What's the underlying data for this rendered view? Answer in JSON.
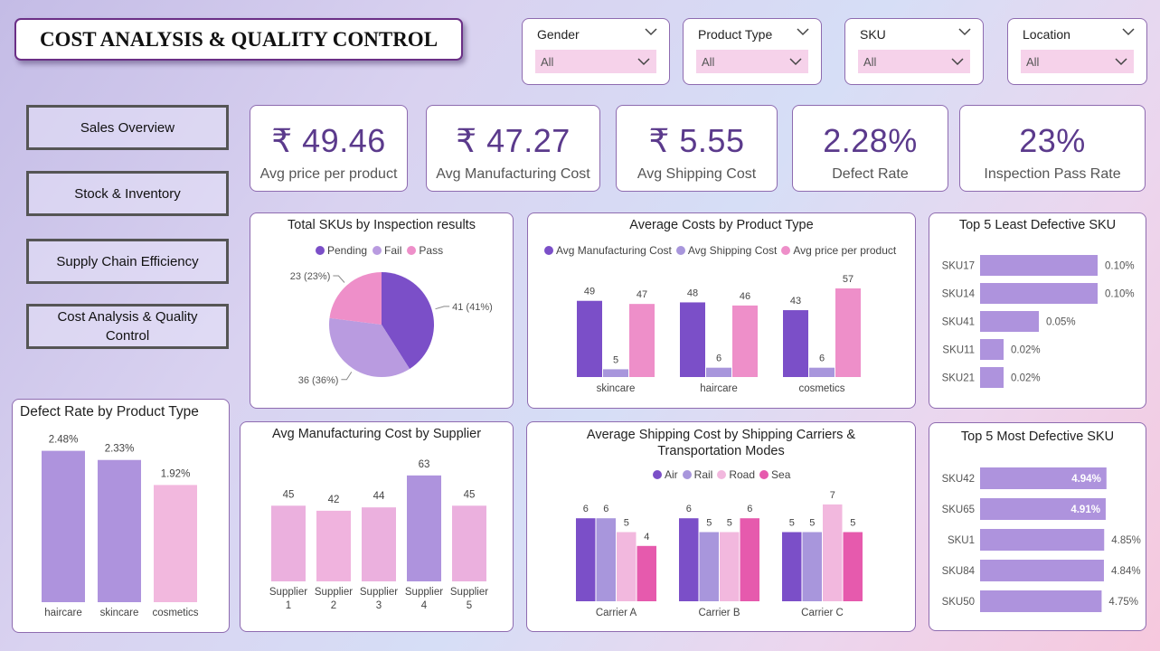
{
  "header": {
    "title": "COST ANALYSIS & QUALITY CONTROL"
  },
  "filters": [
    {
      "label": "Gender",
      "value": "All"
    },
    {
      "label": "Product Type",
      "value": "All"
    },
    {
      "label": "SKU",
      "value": "All"
    },
    {
      "label": "Location",
      "value": "All"
    }
  ],
  "nav": [
    "Sales Overview",
    "Stock & Inventory",
    "Supply Chain Efficiency",
    "Cost Analysis & Quality Control"
  ],
  "kpis": [
    {
      "value": "₹ 49.46",
      "label": "Avg price per product"
    },
    {
      "value": "₹ 47.27",
      "label": "Avg Manufacturing Cost"
    },
    {
      "value": "₹ 5.55",
      "label": "Avg Shipping Cost"
    },
    {
      "value": "2.28%",
      "label": "Defect Rate"
    },
    {
      "value": "23%",
      "label": "Inspection Pass Rate"
    }
  ],
  "colors": {
    "purple_dark": "#7b4fc8",
    "purple_light": "#a896dc",
    "pink": "#ee8fc9",
    "pink_light": "#f2b8de",
    "hot_pink": "#e65aad",
    "bar_lavender": "#ae93dd"
  },
  "chart_data": [
    {
      "id": "pie",
      "type": "pie",
      "title": "Total SKUs by Inspection results",
      "legend": [
        "Pending",
        "Fail",
        "Pass"
      ],
      "slices": [
        {
          "name": "Pending",
          "value": 41,
          "label": "41 (41%)",
          "color": "#7b4fc8"
        },
        {
          "name": "Fail",
          "value": 36,
          "label": "36 (36%)",
          "color": "#b99be0"
        },
        {
          "name": "Pass",
          "value": 23,
          "label": "23 (23%)",
          "color": "#ee8fc9"
        }
      ]
    },
    {
      "id": "avgcost",
      "type": "bar",
      "title": "Average Costs by Product Type",
      "legend": [
        "Avg Manufacturing Cost",
        "Avg Shipping Cost",
        "Avg price per product"
      ],
      "categories": [
        "skincare",
        "haircare",
        "cosmetics"
      ],
      "series": [
        {
          "name": "Avg Manufacturing Cost",
          "values": [
            49,
            48,
            43
          ],
          "color": "#7b4fc8"
        },
        {
          "name": "Avg Shipping Cost",
          "values": [
            5,
            6,
            6
          ],
          "color": "#a896dc"
        },
        {
          "name": "Avg price per product",
          "values": [
            47,
            46,
            57
          ],
          "color": "#ee8fc9"
        }
      ]
    },
    {
      "id": "least",
      "type": "bar",
      "orientation": "horizontal",
      "title": "Top 5 Least Defective SKU",
      "categories": [
        "SKU17",
        "SKU14",
        "SKU41",
        "SKU11",
        "SKU21"
      ],
      "values": [
        0.1,
        0.1,
        0.05,
        0.02,
        0.02
      ],
      "labels": [
        "0.10%",
        "0.10%",
        "0.05%",
        "0.02%",
        "0.02%"
      ]
    },
    {
      "id": "defect",
      "type": "bar",
      "title": "Defect Rate by Product Type",
      "categories": [
        "haircare",
        "skincare",
        "cosmetics"
      ],
      "values": [
        2.48,
        2.33,
        1.92
      ],
      "labels": [
        "2.48%",
        "2.33%",
        "1.92%"
      ],
      "colors": [
        "#ae93dd",
        "#ae93dd",
        "#f2b8de"
      ]
    },
    {
      "id": "supplier",
      "type": "bar",
      "title": "Avg Manufacturing Cost by Supplier",
      "categories": [
        "Supplier 1",
        "Supplier 2",
        "Supplier 3",
        "Supplier 4",
        "Supplier 5"
      ],
      "values": [
        45,
        42,
        44,
        63,
        45
      ],
      "colors": [
        "#ebb0de",
        "#f0b3de",
        "#ebb0de",
        "#ae93dd",
        "#ebb0de"
      ]
    },
    {
      "id": "shipping",
      "type": "bar",
      "title": "Average Shipping Cost by Shipping Carriers & Transportation Modes",
      "legend": [
        "Air",
        "Rail",
        "Road",
        "Sea"
      ],
      "categories": [
        "Carrier A",
        "Carrier B",
        "Carrier C"
      ],
      "series": [
        {
          "name": "Air",
          "values": [
            6,
            6,
            5
          ],
          "color": "#7b4fc8"
        },
        {
          "name": "Rail",
          "values": [
            6,
            5,
            5
          ],
          "color": "#a896dc"
        },
        {
          "name": "Road",
          "values": [
            5,
            5,
            7
          ],
          "color": "#f2b8de"
        },
        {
          "name": "Sea",
          "values": [
            4,
            6,
            5
          ],
          "color": "#e65aad"
        }
      ]
    },
    {
      "id": "most",
      "type": "bar",
      "orientation": "horizontal",
      "title": "Top 5 Most Defective SKU",
      "categories": [
        "SKU42",
        "SKU65",
        "SKU1",
        "SKU84",
        "SKU50"
      ],
      "values": [
        4.94,
        4.91,
        4.85,
        4.84,
        4.75
      ],
      "labels": [
        "4.94%",
        "4.91%",
        "4.85%",
        "4.84%",
        "4.75%"
      ]
    }
  ]
}
